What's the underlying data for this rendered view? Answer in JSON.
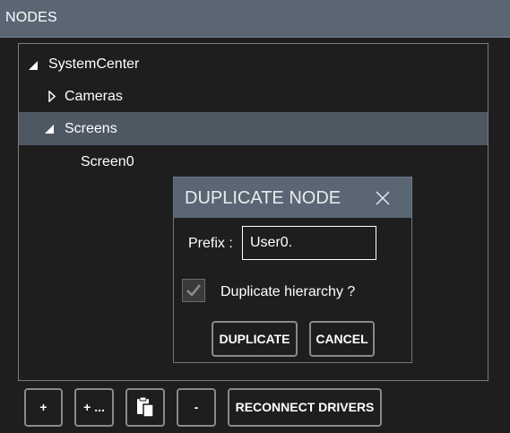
{
  "header": {
    "title": "NODES"
  },
  "tree": {
    "root": {
      "label": "SystemCenter",
      "expanded": true
    },
    "cameras": {
      "label": "Cameras",
      "expanded": false
    },
    "screens": {
      "label": "Screens",
      "expanded": true,
      "selected": true
    },
    "screen0": {
      "label": "Screen0"
    }
  },
  "dialog": {
    "title": "DUPLICATE NODE",
    "prefix_label": "Prefix :",
    "prefix_value": "User0.",
    "checkbox_label": "Duplicate hierarchy ?",
    "checkbox_checked": true,
    "duplicate_label": "DUPLICATE",
    "cancel_label": "CANCEL"
  },
  "toolbar": {
    "add_label": "+",
    "add_more_label": "+ ...",
    "paste_icon": "paste-icon",
    "remove_label": "-",
    "reconnect_label": "RECONNECT DRIVERS"
  },
  "colors": {
    "background": "#1e1e1e",
    "header": "#5a6673",
    "selected_row": "#4d5863",
    "border": "#7a7a7a"
  }
}
